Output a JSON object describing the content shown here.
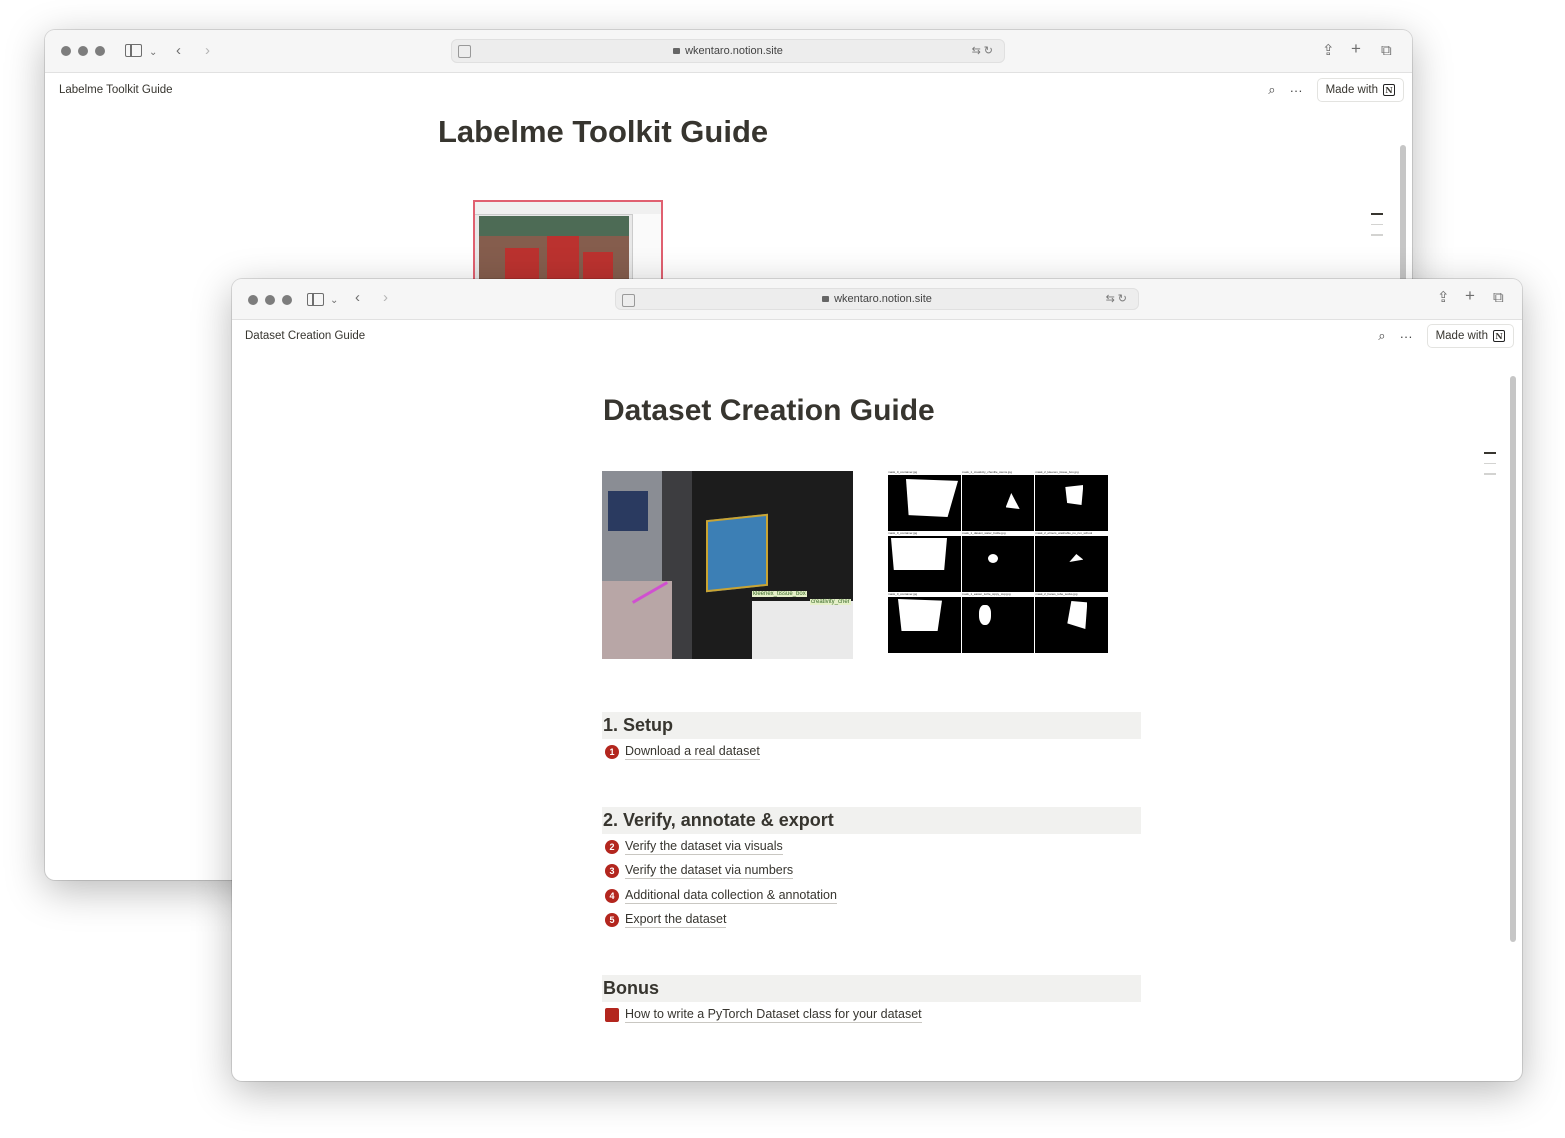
{
  "browser": {
    "url": "wkentaro.notion.site"
  },
  "back_window": {
    "breadcrumb": "Labelme Toolkit Guide",
    "title": "Labelme Toolkit Guide",
    "made_with": "Made with"
  },
  "front_window": {
    "breadcrumb": "Dataset Creation Guide",
    "title": "Dataset Creation Guide",
    "made_with": "Made with",
    "scene_labels": [
      "kleenex_tissue_box",
      "creativity_cher"
    ],
    "mask_captions": [
      "mask_0_container.jpg",
      "mask_1_creativity_chenille_stems.jpg",
      "mask_2_kleenex_tissue_box.jpg",
      "mask_0_container.jpg",
      "mask_1_dasani_water_bottle.jpg",
      "mask_2_elmers_washable_no_run_school",
      "mask_0_container.jpg",
      "mask_1_easter_turtle_sippy_cup.jpg",
      "mask_2_hanes_tube_socks.jpg"
    ],
    "sections": [
      {
        "heading": "1. Setup",
        "items": [
          {
            "num": "1",
            "label": "Download a real dataset"
          }
        ]
      },
      {
        "heading": "2. Verify, annotate & export",
        "items": [
          {
            "num": "2",
            "label": "Verify the dataset via visuals"
          },
          {
            "num": "3",
            "label": "Verify the dataset via numbers"
          },
          {
            "num": "4",
            "label": "Additional data collection & annotation"
          },
          {
            "num": "5",
            "label": "Export the dataset"
          }
        ]
      },
      {
        "heading": "Bonus",
        "items": [
          {
            "num": "",
            "label": "How to write a PyTorch Dataset class for your dataset"
          }
        ]
      }
    ]
  },
  "colors": {
    "accent_red": "#b3261e",
    "heading_bg": "#f1f1ef",
    "text": "#37352f"
  }
}
